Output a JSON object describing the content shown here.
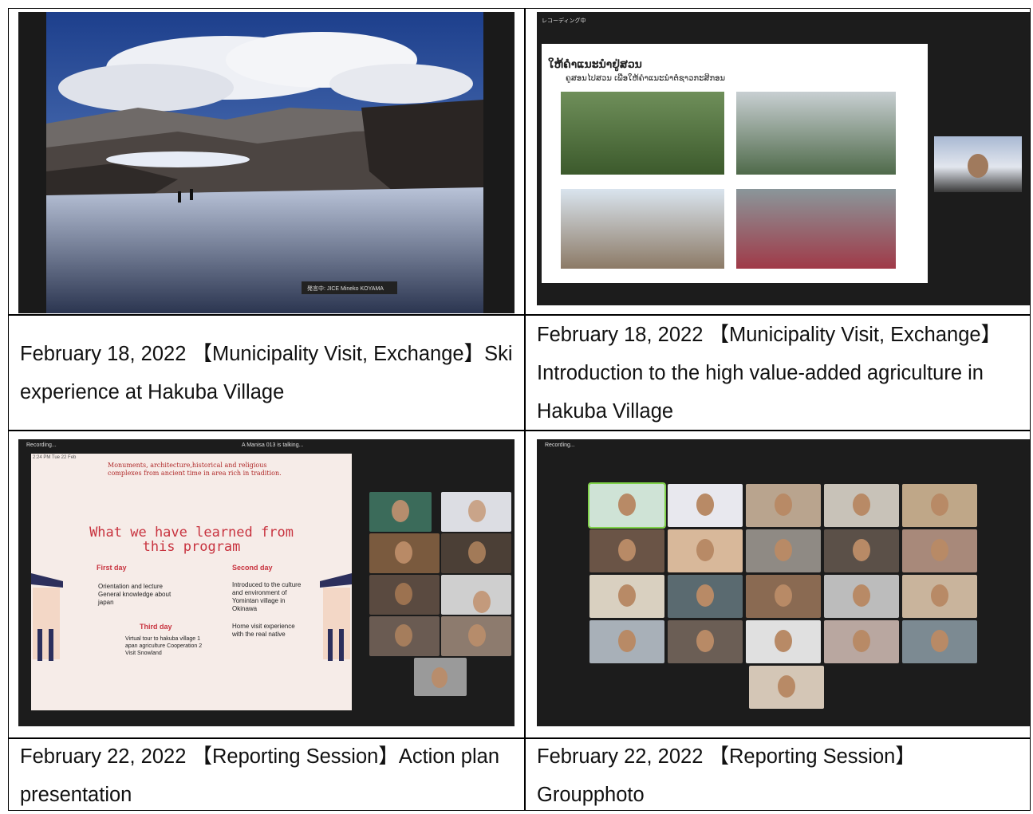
{
  "captions": {
    "c1": "February 18, 2022 【Municipality Visit, Exchange】Ski experience at Hakuba Village",
    "c2": "February 18, 2022 【Municipality Visit, Exchange】Introduction to the high value-added agriculture in Hakuba Village",
    "c3": "February 22, 2022 【Reporting Session】Action plan presentation",
    "c4": "February 22, 2022 【Reporting Session】Groupphoto"
  },
  "photo1": {
    "name_tag": "発言中: JICE Mineko KOYAMA"
  },
  "photo2": {
    "recording": "レコーディング中",
    "slide_title": "ໃຫ້ຄຳແນະນຳຢູ່ສວນ",
    "slide_subtitle": "ຄູສອນໄປສວນ ເພື່ອໃຫ້ຄຳແນະນຳຕໍ່ຊາວກະສິກອນ"
  },
  "photo3": {
    "recording": "Recording...",
    "talking": "A Manisa 013 is talking...",
    "clock": "2:24 PM  Tue 22 Feb",
    "bullet": "Monuments, architecture,historical and religious complexes from ancient time in area rich in tradition.",
    "slide_title_1": "What we have learned from",
    "slide_title_2": "this program",
    "first_day_h": "First day",
    "first_day_body": "Orientation and lecture General knowledge about japan",
    "second_day_h": "Second day",
    "second_day_items": [
      "Introduced to the culture and environment of Yomintan village in Okinawa",
      "Home visit experience with the real native"
    ],
    "third_day_h": "Third day",
    "third_day_body": "Virtual tour to hakuba village 1 apan agriculture Cooperation 2 Visit Snowland"
  },
  "photo4": {
    "recording": "Recording..."
  }
}
